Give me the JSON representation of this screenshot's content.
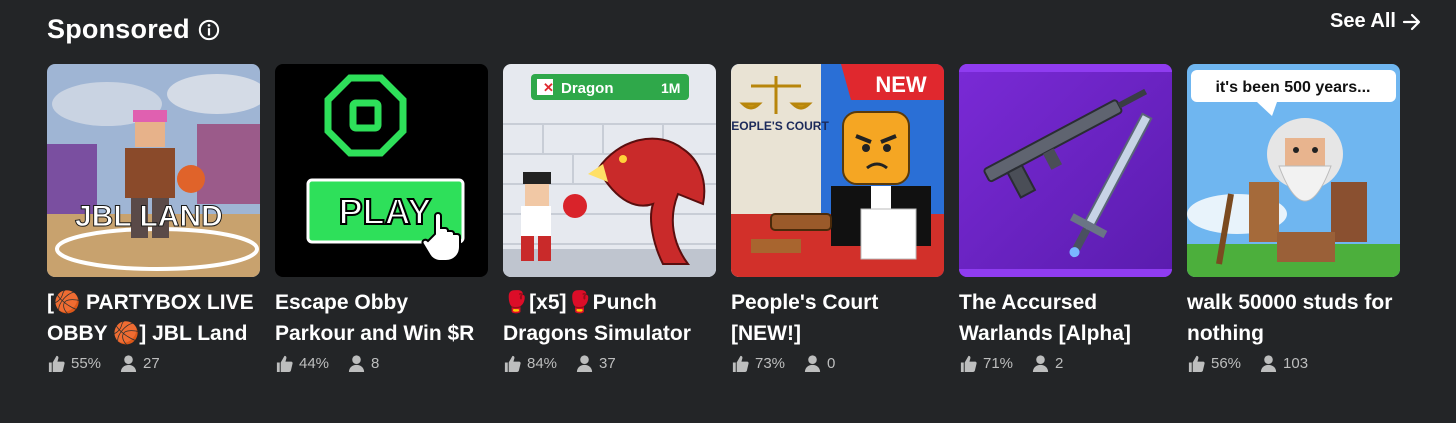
{
  "section": {
    "title": "Sponsored",
    "see_all_label": "See All"
  },
  "icons": {
    "info": "info-circle-icon",
    "arrow": "arrow-right-icon",
    "thumbs": "thumbs-up-icon",
    "players": "player-icon"
  },
  "colors": {
    "background": "#232527",
    "text": "#ffffff",
    "muted": "#bdbebe"
  },
  "cards": [
    {
      "title": "[🏀 PARTYBOX LIVE OBBY 🏀] JBL Land",
      "rating": "55%",
      "players": "27",
      "thumb_text": "JBL LAND"
    },
    {
      "title": "Escape Obby Parkour and Win $R",
      "rating": "44%",
      "players": "8",
      "thumb_text": "PLAY"
    },
    {
      "title": "🥊[x5]🥊Punch Dragons Simulator",
      "rating": "84%",
      "players": "37",
      "thumb_text": "Dragon",
      "thumb_badge": "1M"
    },
    {
      "title": "People's Court [NEW!]",
      "rating": "73%",
      "players": "0",
      "thumb_text": "PEOPLE'S COURT",
      "thumb_badge": "NEW"
    },
    {
      "title": "The Accursed Warlands [Alpha]",
      "rating": "71%",
      "players": "2"
    },
    {
      "title": "walk 50000 studs for nothing",
      "rating": "56%",
      "players": "103",
      "thumb_text": "it's been 500 years..."
    }
  ]
}
